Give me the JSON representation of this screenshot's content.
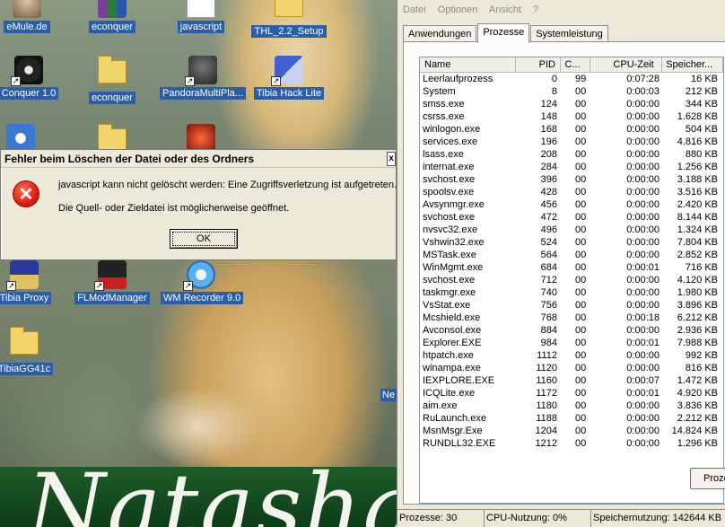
{
  "desktop": {
    "icons": [
      {
        "label": "eMule.de",
        "icon": "emule-icon"
      },
      {
        "label": "econquer",
        "icon": "winrar-archive-icon"
      },
      {
        "label": "javascript",
        "icon": "blank-document-icon"
      },
      {
        "label": "THL_2.2_Setup",
        "icon": "setup-folder-icon"
      },
      {
        "label": "Conquer 1.0",
        "icon": "conquer-game-icon"
      },
      {
        "label": "econquer",
        "icon": "folder-icon"
      },
      {
        "label": "PandoraMultiPla...",
        "icon": "pandora-app-icon"
      },
      {
        "label": "Tibia Hack Lite",
        "icon": "tibia-hack-icon"
      },
      {
        "label": "Tibia Proxy",
        "icon": "tibia-proxy-icon"
      },
      {
        "label": "FLModManager",
        "icon": "flmod-icon"
      },
      {
        "label": "WM Recorder 9.0",
        "icon": "wm-recorder-icon"
      },
      {
        "label": "TibiaGG41c",
        "icon": "folder-icon"
      }
    ],
    "edge_label": "Ne",
    "wallpaper_text": "Natasha"
  },
  "dialog": {
    "title": "Fehler beim Löschen der Datei oder des Ordners",
    "close_glyph": "x",
    "message_line1": "javascript kann nicht gelöscht werden: Eine Zugriffsverletzung ist aufgetreten.",
    "message_line2": "Die Quell- oder Zieldatei ist möglicherweise geöffnet.",
    "ok_label": "OK",
    "icon": "error-icon"
  },
  "taskmgr": {
    "menu": [
      "Datei",
      "Optionen",
      "Ansicht",
      "?"
    ],
    "tabs": [
      "Anwendungen",
      "Prozesse",
      "Systemleistung"
    ],
    "active_tab": "Prozesse",
    "columns": [
      "Name",
      "PID",
      "C...",
      "CPU-Zeit",
      "Speicher..."
    ],
    "processes": [
      {
        "name": "Leerlaufprozess",
        "pid": "0",
        "cpu": "99",
        "time": "0:07:28",
        "mem": "16 KB"
      },
      {
        "name": "System",
        "pid": "8",
        "cpu": "00",
        "time": "0:00:03",
        "mem": "212 KB"
      },
      {
        "name": "smss.exe",
        "pid": "124",
        "cpu": "00",
        "time": "0:00:00",
        "mem": "344 KB"
      },
      {
        "name": "csrss.exe",
        "pid": "148",
        "cpu": "00",
        "time": "0:00:00",
        "mem": "1.628 KB"
      },
      {
        "name": "winlogon.exe",
        "pid": "168",
        "cpu": "00",
        "time": "0:00:00",
        "mem": "504 KB"
      },
      {
        "name": "services.exe",
        "pid": "196",
        "cpu": "00",
        "time": "0:00:00",
        "mem": "4.816 KB"
      },
      {
        "name": "lsass.exe",
        "pid": "208",
        "cpu": "00",
        "time": "0:00:00",
        "mem": "880 KB"
      },
      {
        "name": "internat.exe",
        "pid": "284",
        "cpu": "00",
        "time": "0:00:00",
        "mem": "1.256 KB"
      },
      {
        "name": "svchost.exe",
        "pid": "396",
        "cpu": "00",
        "time": "0:00:00",
        "mem": "3.188 KB"
      },
      {
        "name": "spoolsv.exe",
        "pid": "428",
        "cpu": "00",
        "time": "0:00:00",
        "mem": "3.516 KB"
      },
      {
        "name": "Avsynmgr.exe",
        "pid": "456",
        "cpu": "00",
        "time": "0:00:00",
        "mem": "2.420 KB"
      },
      {
        "name": "svchost.exe",
        "pid": "472",
        "cpu": "00",
        "time": "0:00:00",
        "mem": "8.144 KB"
      },
      {
        "name": "nvsvc32.exe",
        "pid": "496",
        "cpu": "00",
        "time": "0:00:00",
        "mem": "1.324 KB"
      },
      {
        "name": "Vshwin32.exe",
        "pid": "524",
        "cpu": "00",
        "time": "0:00:00",
        "mem": "7.804 KB"
      },
      {
        "name": "MSTask.exe",
        "pid": "564",
        "cpu": "00",
        "time": "0:00:00",
        "mem": "2.852 KB"
      },
      {
        "name": "WinMgmt.exe",
        "pid": "684",
        "cpu": "00",
        "time": "0:00:01",
        "mem": "716 KB"
      },
      {
        "name": "svchost.exe",
        "pid": "712",
        "cpu": "00",
        "time": "0:00:00",
        "mem": "4.120 KB"
      },
      {
        "name": "taskmgr.exe",
        "pid": "740",
        "cpu": "00",
        "time": "0:00:00",
        "mem": "1.980 KB"
      },
      {
        "name": "VsStat.exe",
        "pid": "756",
        "cpu": "00",
        "time": "0:00:00",
        "mem": "3.896 KB"
      },
      {
        "name": "Mcshield.exe",
        "pid": "768",
        "cpu": "00",
        "time": "0:00:18",
        "mem": "6.212 KB"
      },
      {
        "name": "Avconsol.exe",
        "pid": "884",
        "cpu": "00",
        "time": "0:00:00",
        "mem": "2.936 KB"
      },
      {
        "name": "Explorer.EXE",
        "pid": "984",
        "cpu": "00",
        "time": "0:00:01",
        "mem": "7.988 KB"
      },
      {
        "name": "htpatch.exe",
        "pid": "1112",
        "cpu": "00",
        "time": "0:00:00",
        "mem": "992 KB"
      },
      {
        "name": "winampa.exe",
        "pid": "1120",
        "cpu": "00",
        "time": "0:00:00",
        "mem": "816 KB"
      },
      {
        "name": "IEXPLORE.EXE",
        "pid": "1160",
        "cpu": "00",
        "time": "0:00:07",
        "mem": "1.472 KB"
      },
      {
        "name": "ICQLite.exe",
        "pid": "1172",
        "cpu": "00",
        "time": "0:00:01",
        "mem": "4.920 KB"
      },
      {
        "name": "aim.exe",
        "pid": "1180",
        "cpu": "00",
        "time": "0:00:00",
        "mem": "3.836 KB"
      },
      {
        "name": "RuLaunch.exe",
        "pid": "1188",
        "cpu": "00",
        "time": "0:00:00",
        "mem": "2.212 KB"
      },
      {
        "name": "MsnMsgr.Exe",
        "pid": "1204",
        "cpu": "00",
        "time": "0:00:00",
        "mem": "14.824 KB"
      },
      {
        "name": "RUNDLL32.EXE",
        "pid": "1212",
        "cpu": "00",
        "time": "0:00:00",
        "mem": "1.296 KB"
      }
    ],
    "end_button": "Proze",
    "status": {
      "processes": "Prozesse: 30",
      "cpu": "CPU-Nutzung: 0%",
      "memory": "Speichernutzung: 142644 KB"
    }
  }
}
